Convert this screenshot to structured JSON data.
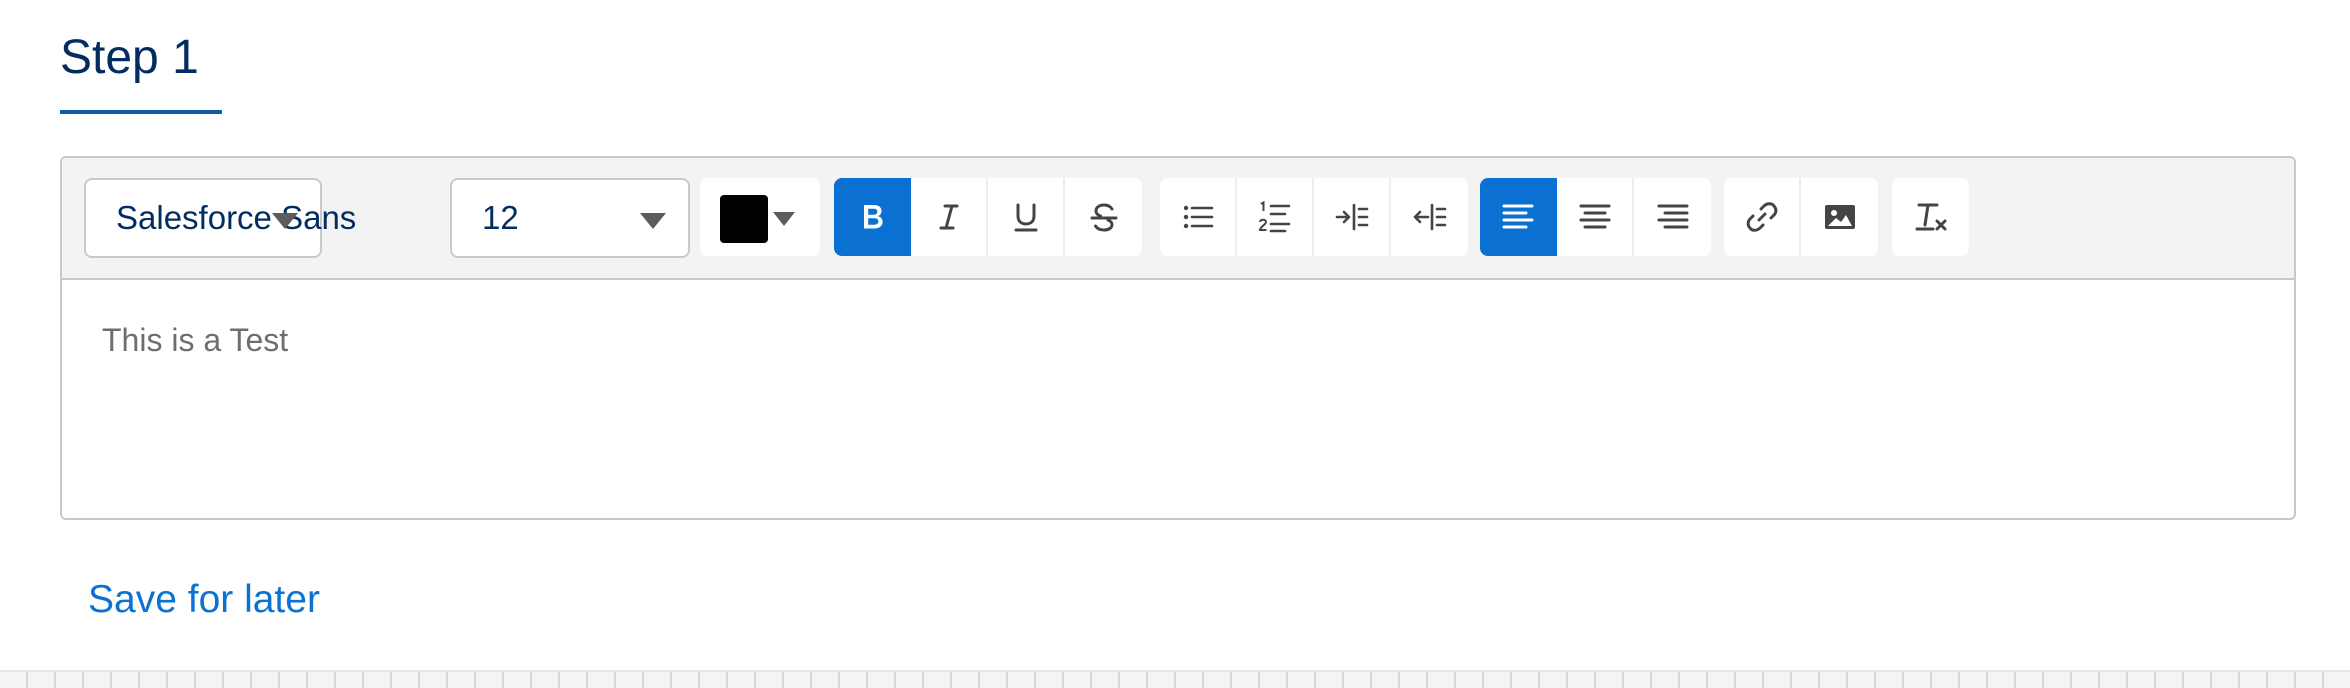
{
  "tab": {
    "title": "Step 1"
  },
  "toolbar": {
    "font_family": "Salesforce Sans",
    "font_size": "12",
    "text_color": "#000000",
    "accent_color": "#0a70d2"
  },
  "editor": {
    "content": "This is a Test"
  },
  "actions": {
    "save_later": "Save for later"
  }
}
